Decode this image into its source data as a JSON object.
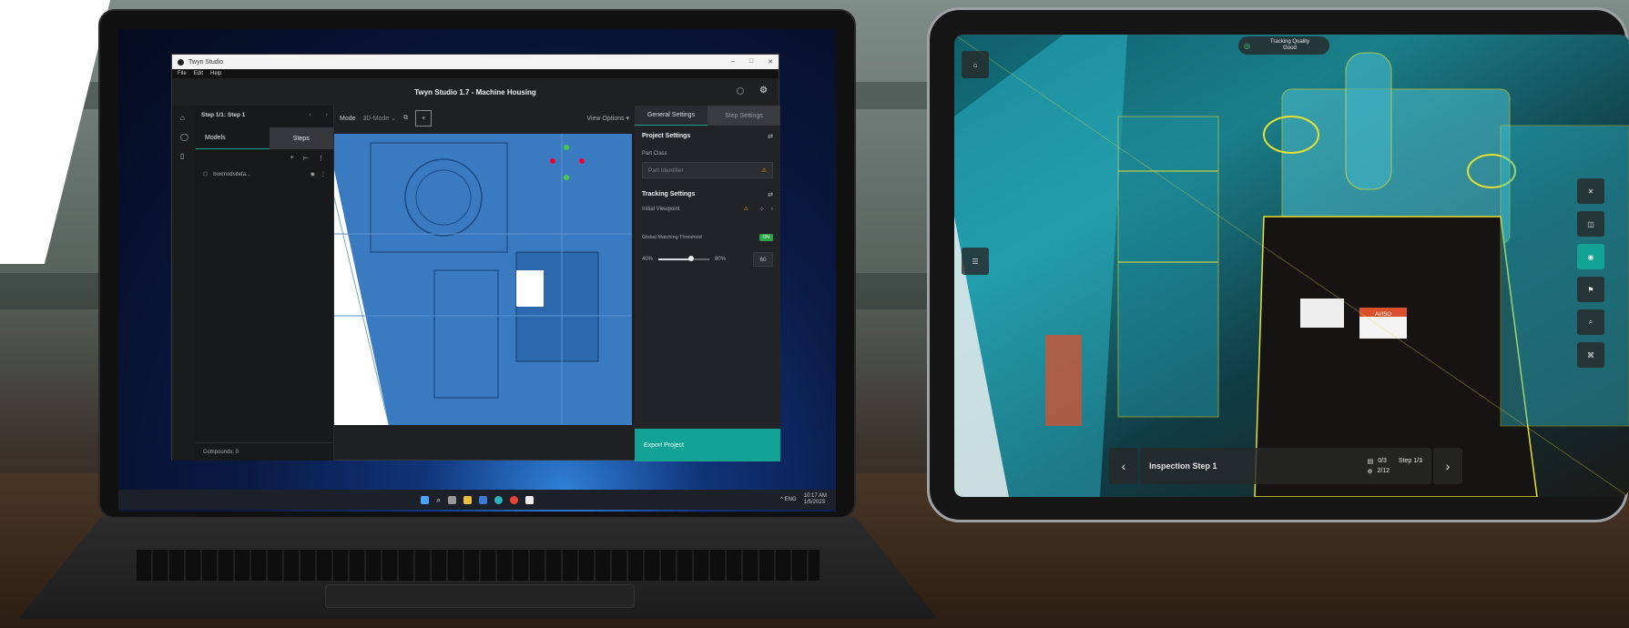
{
  "laptop": {
    "window_title": "Twyn Studio",
    "menu": [
      "File",
      "Edit",
      "Help"
    ],
    "app_title": "Twyn Studio 1.7 - Machine Housing",
    "step": {
      "label": "Step 1/1: Step 1"
    },
    "left_tabs": [
      "Models",
      "Steps"
    ],
    "model_item": "boxmodsitefa...",
    "compounds": "Compounds: 0",
    "toolbar": {
      "mode_label": "Mode",
      "mode_value": "3D-Mode",
      "view_options": "View Options"
    },
    "right_tabs": [
      "General Settings",
      "Step Settings"
    ],
    "project_settings": {
      "title": "Project Settings",
      "part_class_label": "Part Class",
      "part_identifier_placeholder": "Part Identifier"
    },
    "tracking_settings": {
      "title": "Tracking Settings",
      "initial_viewpoint": "Initial Viewpoint",
      "threshold_label": "Global Matching Threshold",
      "toggle_label": "ON",
      "min": "40%",
      "max": "80%",
      "value": "60",
      "slider_fraction": 0.65
    },
    "export_button": "Export Project",
    "taskbar": {
      "tray": "^ ENG",
      "time": "10:17 AM",
      "date": "1/5/2023"
    }
  },
  "tablet": {
    "tracking_quality_label": "Tracking Quality",
    "tracking_quality_value": "Good",
    "inspection_step": "Inspection Step 1",
    "progress_1": "0/3",
    "step_counter": "Step 1/3",
    "progress_2": "2/12",
    "prev": "‹",
    "next": "›",
    "sticker_text": "AVISO"
  },
  "colors": {
    "accent": "#13a394",
    "model_blue": "#2f78c4",
    "overlay_cyan": "#2ec4d8",
    "edge_yellow": "#e8e030"
  }
}
